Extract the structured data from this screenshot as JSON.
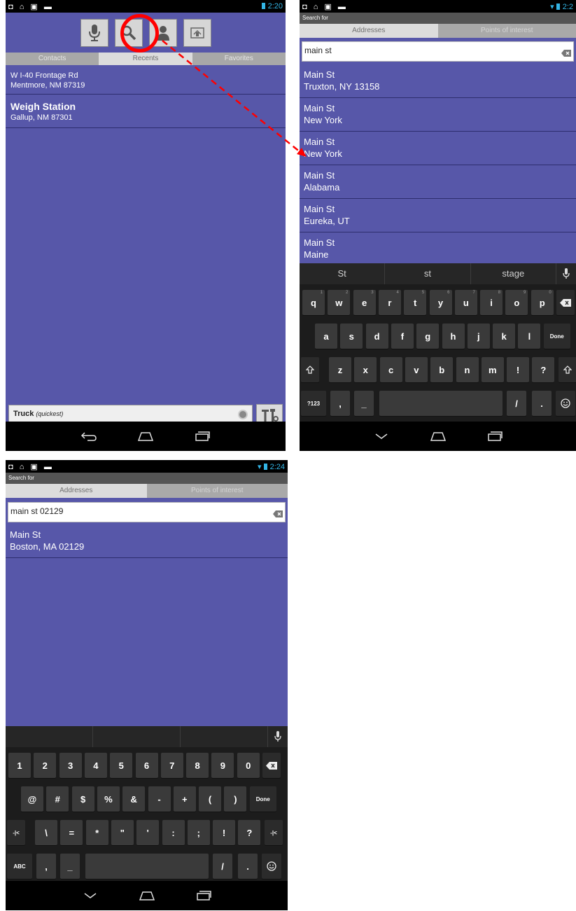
{
  "screen1": {
    "status": {
      "icons": "◘ ⌂ ▣ ▬",
      "time": "2:20"
    },
    "toolbar": {
      "icons": [
        "microphone-icon",
        "search-icon",
        "person-icon",
        "map-icon"
      ]
    },
    "tabs": [
      "Contacts",
      "Recents",
      "Favorites"
    ],
    "active_tab": "Recents",
    "results": [
      {
        "line1": "W I-40 Frontage Rd",
        "line2": "Mentmore, NM 87319"
      },
      {
        "line1": "Weigh Station",
        "line2": "Gallup, NM 87301"
      }
    ],
    "route": {
      "mode": "Truck",
      "qualifier": "(quickest)"
    }
  },
  "screen2": {
    "status": {
      "icons": "◘ ⌂ ▣ ▬",
      "time": "2:2"
    },
    "header": "Search for",
    "tabs": [
      "Addresses",
      "Points of interest"
    ],
    "search_value": "main st",
    "results": [
      {
        "line1": "Main St",
        "line2": "Truxton, NY 13158"
      },
      {
        "line1": "Main St",
        "line2": "New York"
      },
      {
        "line1": "Main St",
        "line2": "New York"
      },
      {
        "line1": "Main St",
        "line2": "Alabama"
      },
      {
        "line1": "Main St",
        "line2": "Eureka, UT"
      },
      {
        "line1": "Main St",
        "line2": "Maine"
      }
    ],
    "keyboard": {
      "suggestions": [
        "St",
        "st",
        "stage"
      ],
      "row1": [
        "q",
        "w",
        "e",
        "r",
        "t",
        "y",
        "u",
        "i",
        "o",
        "p"
      ],
      "row1_hints": [
        "1",
        "2",
        "3",
        "4",
        "5",
        "6",
        "7",
        "8",
        "9",
        "0"
      ],
      "row2": [
        "a",
        "s",
        "d",
        "f",
        "g",
        "h",
        "j",
        "k",
        "l"
      ],
      "done": "Done",
      "row3": [
        "z",
        "x",
        "c",
        "v",
        "b",
        "n",
        "m",
        "!",
        "?"
      ],
      "mode_key": "?123",
      "row4": [
        ",",
        "_",
        "/",
        "."
      ]
    }
  },
  "screen3": {
    "status": {
      "icons": "◘ ⌂ ▣ ▬",
      "time": "2:24"
    },
    "header": "Search for",
    "tabs": [
      "Addresses",
      "Points of interest"
    ],
    "search_value": "main st 02129",
    "results": [
      {
        "line1": "Main St",
        "line2": "Boston, MA 02129"
      }
    ],
    "keyboard": {
      "row1": [
        "1",
        "2",
        "3",
        "4",
        "5",
        "6",
        "7",
        "8",
        "9",
        "0"
      ],
      "row2": [
        "@",
        "#",
        "$",
        "%",
        "&",
        "-",
        "+",
        "(",
        ")"
      ],
      "done": "Done",
      "row3": [
        "\\",
        "=",
        "*",
        "\"",
        "'",
        ":",
        ";",
        "!",
        "?"
      ],
      "side_key": "-|<",
      "mode_key": "ABC",
      "row4": [
        ",",
        "_",
        "/",
        "."
      ]
    }
  },
  "colors": {
    "list_bg": "#5757a9",
    "annotation": "#ff0000",
    "status_accent": "#33b5e5"
  }
}
